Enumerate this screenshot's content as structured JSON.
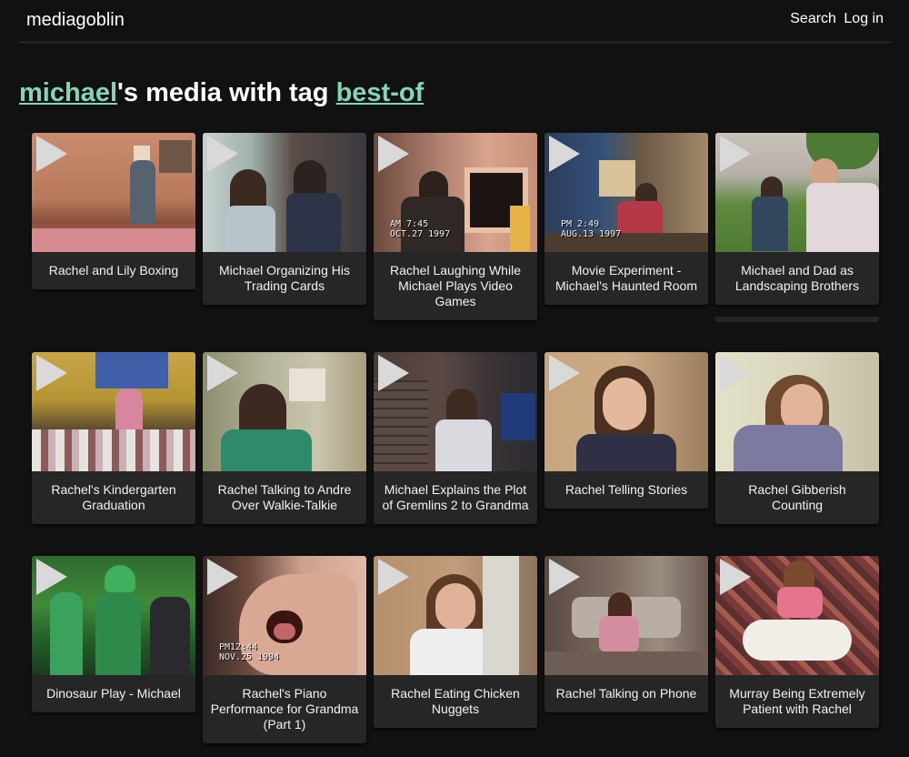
{
  "header": {
    "logo": "mediagoblin",
    "search": "Search",
    "login": "Log in"
  },
  "title": {
    "user": "michael",
    "middle": "'s media with tag ",
    "tag": "best-of"
  },
  "colors": {
    "link_accent": "#86d4b1",
    "card": "#262626",
    "background": "#111111"
  },
  "icons": {
    "play": "play-triangle-icon"
  },
  "media": [
    {
      "title": "Rachel and Lily Boxing"
    },
    {
      "title": "Michael Organizing His Trading Cards"
    },
    {
      "title": "Rachel Laughing While Michael Plays Video Games",
      "vhs": "AM 7:45\nOCT.27 1997"
    },
    {
      "title": "Movie Experiment - Michael's Haunted Room",
      "vhs": "PM 2:49\nAUG.13 1997"
    },
    {
      "title": "Michael and Dad as Landscaping Brothers"
    },
    {
      "title": "Rachel's Kindergarten Graduation"
    },
    {
      "title": "Rachel Talking to Andre Over Walkie-Talkie"
    },
    {
      "title": "Michael Explains the Plot of Gremlins 2 to Grandma"
    },
    {
      "title": "Rachel Telling Stories"
    },
    {
      "title": "Rachel Gibberish Counting"
    },
    {
      "title": "Dinosaur Play - Michael"
    },
    {
      "title": "Rachel's Piano Performance for Grandma (Part 1)",
      "vhs": "PM12:44\nNOV.25 1994"
    },
    {
      "title": "Rachel Eating Chicken Nuggets"
    },
    {
      "title": "Rachel Talking on Phone"
    },
    {
      "title": "Murray Being Extremely Patient with Rachel"
    }
  ]
}
